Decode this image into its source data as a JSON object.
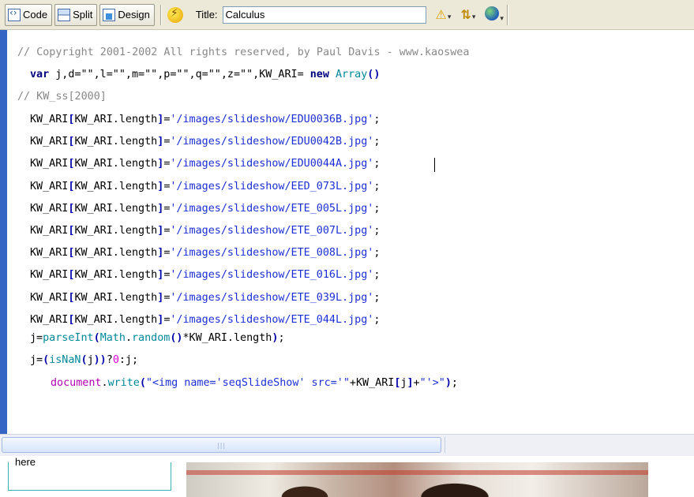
{
  "toolbar": {
    "code_label": "Code",
    "split_label": "Split",
    "design_label": "Design",
    "title_label": "Title:",
    "title_value": "Calculus",
    "icons": [
      "code-view-icon",
      "split-view-icon",
      "design-view-icon",
      "live-view-icon",
      "validation-warning-icon",
      "file-transfer-icon",
      "preview-browser-icon"
    ]
  },
  "code": {
    "line1_comment": "// Copyright 2001-2002 All rights reserved, by Paul Davis - www.kaoswea",
    "line2": {
      "kw": "var",
      "decl": " j,d=\"\",l=\"\",m=\"\",p=\"\",q=\"\",z=\"\",KW_ARI= ",
      "kw2": "new",
      "fn": "Array",
      "punc": "()"
    },
    "line3_comment": "// KW_ss[2000]",
    "array_prefix_a": "KW_ARI",
    "array_prefix_b": "KW_ARI.length",
    "images": [
      "'/images/slideshow/EDU0036B.jpg'",
      "'/images/slideshow/EDU0042B.jpg'",
      "'/images/slideshow/EDU0044A.jpg'",
      "'/images/slideshow/EED_073L.jpg'",
      "'/images/slideshow/ETE_005L.jpg'",
      "'/images/slideshow/ETE_007L.jpg'",
      "'/images/slideshow/ETE_008L.jpg'",
      "'/images/slideshow/ETE_016L.jpg'",
      "'/images/slideshow/ETE_039L.jpg'",
      "'/images/slideshow/ETE_044L.jpg'"
    ],
    "line14": {
      "a": "j=",
      "fn1": "parseInt",
      "fn2": "Math",
      "dot": ".",
      "fn3": "random",
      "b": "*KW_ARI.length",
      "end": ";"
    },
    "line15": {
      "a": "j=",
      "fn": "isNaN",
      "b": "j",
      "c": "?",
      "num": "0",
      "d": ":j;"
    },
    "line16": {
      "obj": "document",
      "dot": ".",
      "fn": "write",
      "s1": "\"<img name='seqSlideShow' src='\"",
      "plus1": "+KW_ARI",
      "idx": "j",
      "plus2": "+",
      "s2": "\"'>\"",
      "end": ";"
    }
  },
  "design": {
    "cell_text": "here"
  },
  "colors": {
    "gutter": "#3465c4",
    "string": "#1d2fd6",
    "keyword": "#000080",
    "comment": "#888888",
    "function": "#008899",
    "number": "#dd00dd"
  }
}
